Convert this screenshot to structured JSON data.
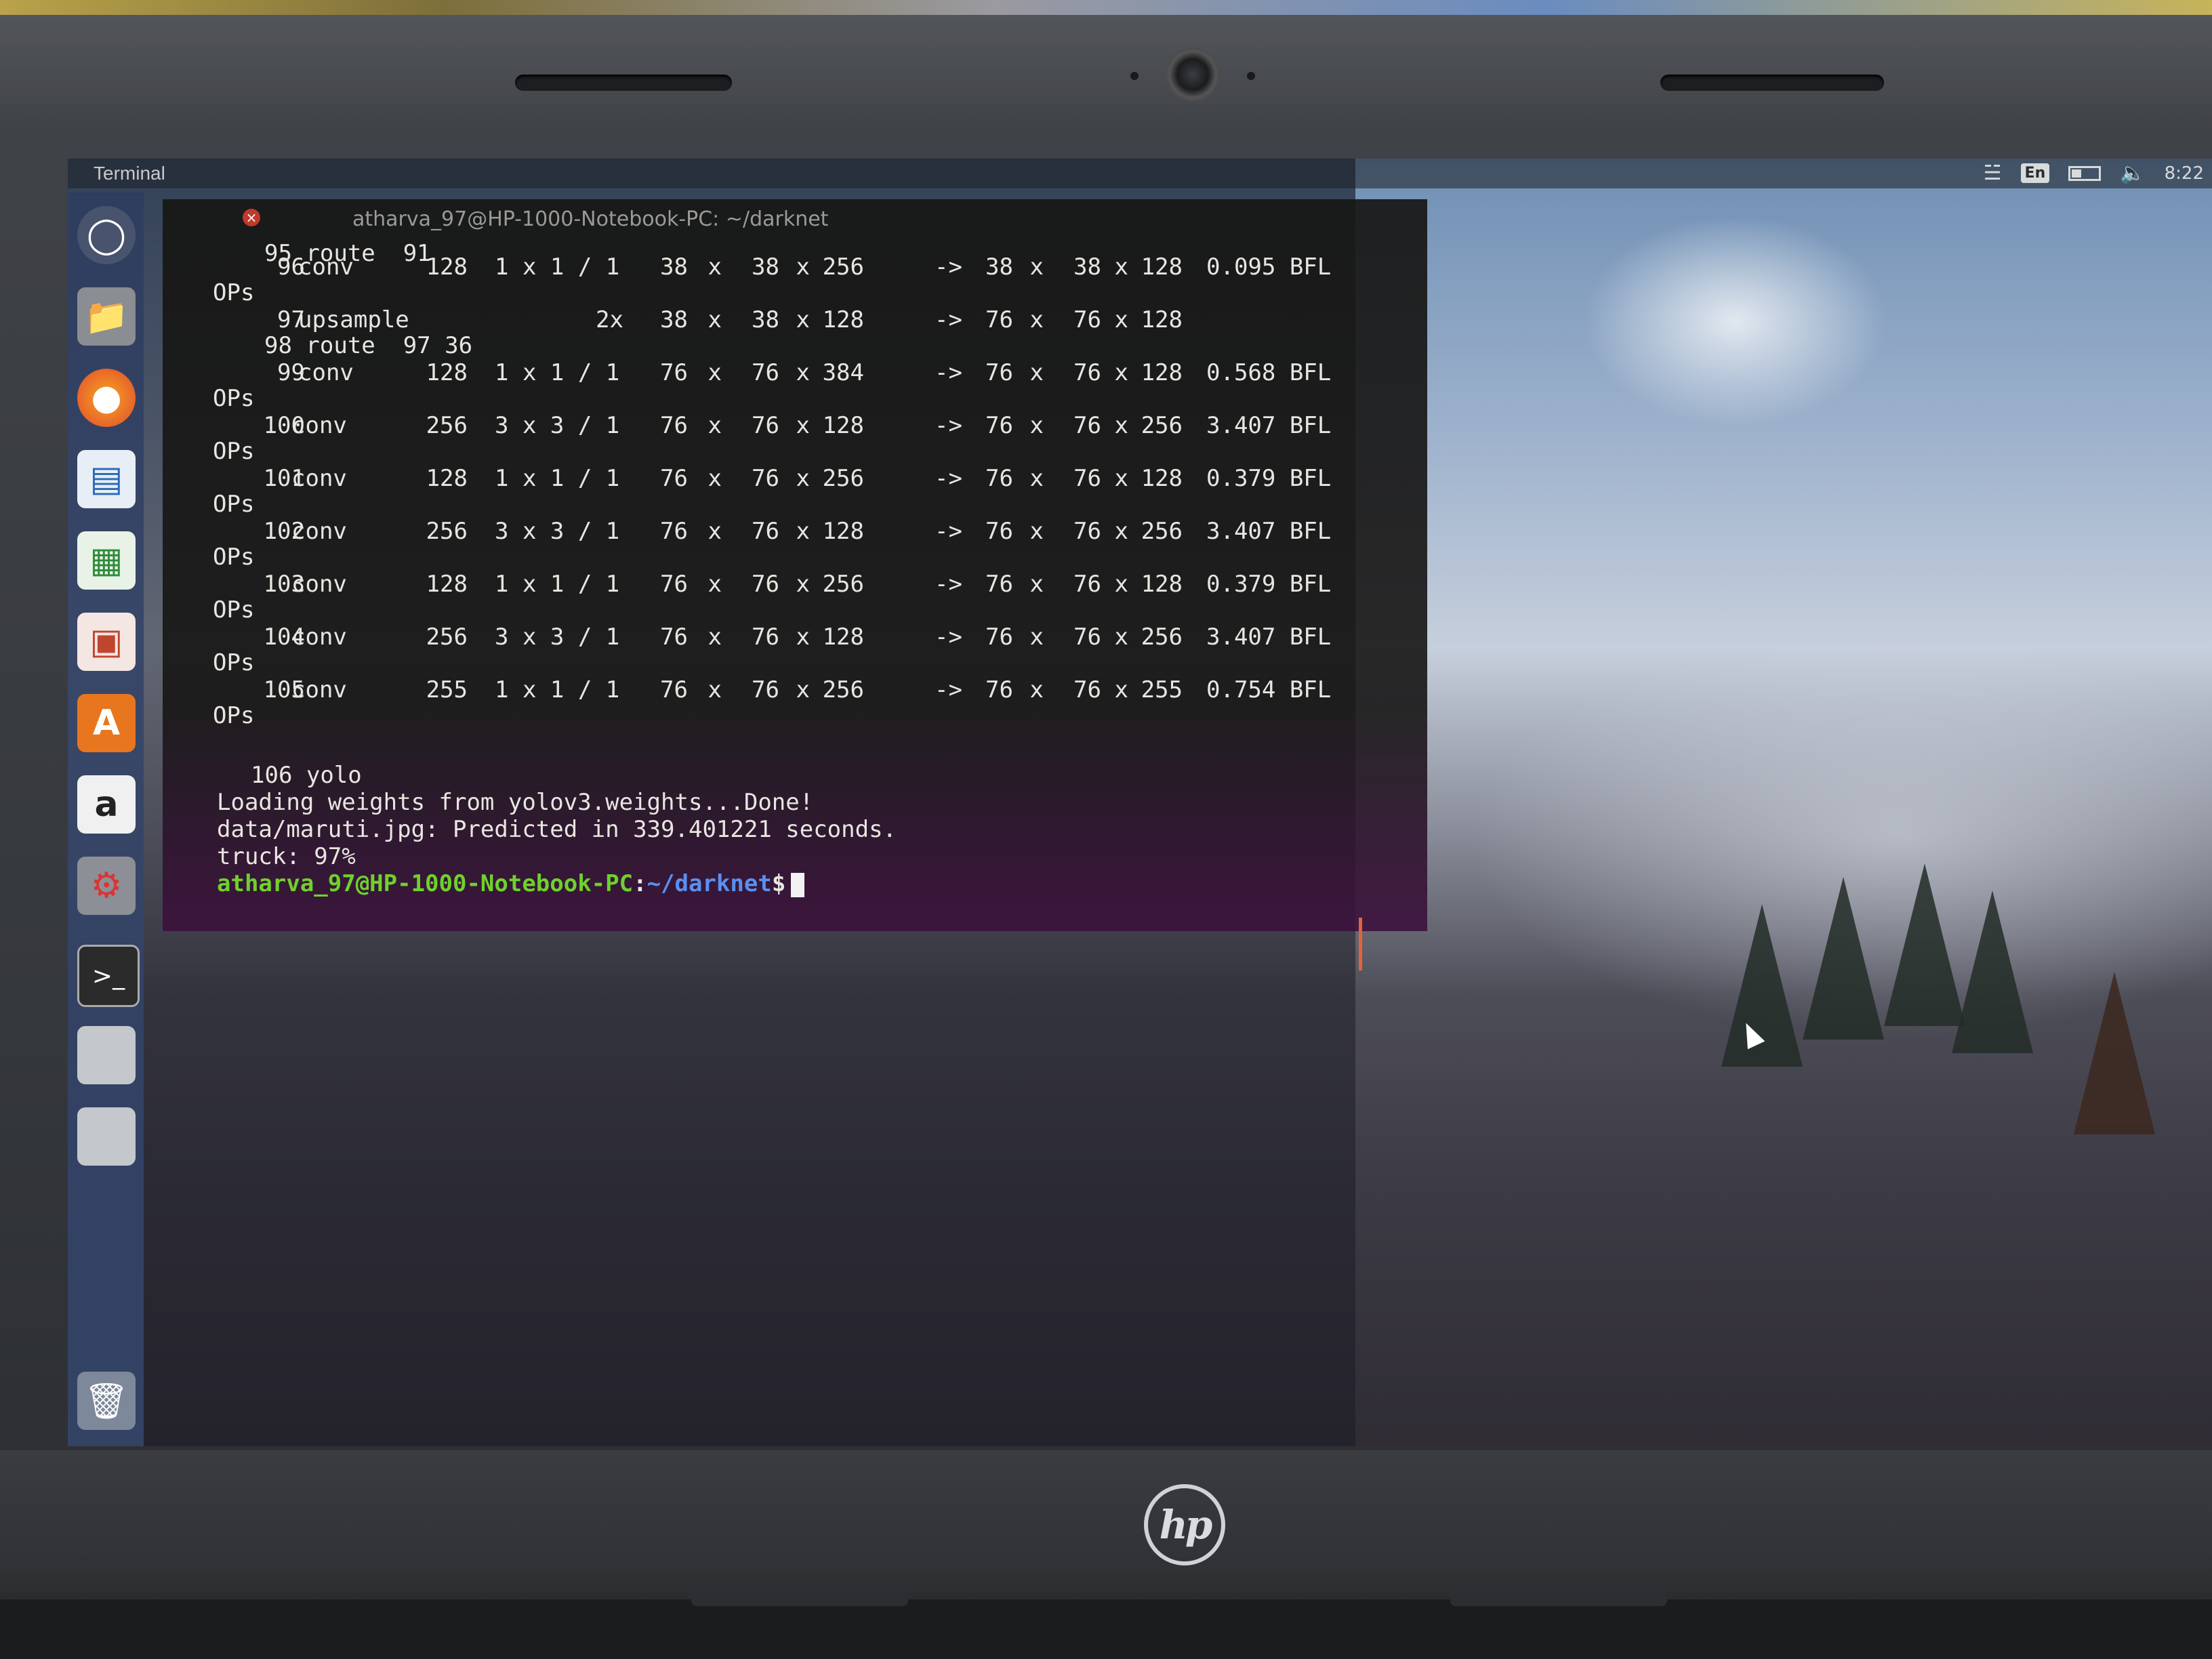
{
  "panel": {
    "app_name": "Terminal",
    "lang": "En",
    "clock": "8:22",
    "icons": {
      "wifi": "wifi-icon",
      "battery": "battery-icon",
      "volume": "volume-icon"
    }
  },
  "terminal": {
    "title": "atharva_97@HP-1000-Notebook-PC: ~/darknet",
    "top_lines": {
      "route95": "95 route  91"
    },
    "layers": [
      {
        "idx": "96",
        "type": "conv",
        "filters": "128",
        "size": "1 x 1 / 1",
        "in_w": "38",
        "in_h": "38",
        "in_c": "256",
        "out_w": "38",
        "out_h": "38",
        "out_c": "128",
        "bflops": "0.095 BFL",
        "ops": "OPs"
      },
      {
        "idx": "97",
        "type": "upsample",
        "filters": "",
        "size": "2x",
        "in_w": "38",
        "in_h": "38",
        "in_c": "128",
        "out_w": "76",
        "out_h": "76",
        "out_c": "128",
        "bflops": "",
        "ops": ""
      },
      {
        "idx": "99",
        "type": "conv",
        "filters": "128",
        "size": "1 x 1 / 1",
        "in_w": "76",
        "in_h": "76",
        "in_c": "384",
        "out_w": "76",
        "out_h": "76",
        "out_c": "128",
        "bflops": "0.568 BFL",
        "ops": "OPs"
      },
      {
        "idx": "100",
        "type": "conv",
        "filters": "256",
        "size": "3 x 3 / 1",
        "in_w": "76",
        "in_h": "76",
        "in_c": "128",
        "out_w": "76",
        "out_h": "76",
        "out_c": "256",
        "bflops": "3.407 BFL",
        "ops": "OPs"
      },
      {
        "idx": "101",
        "type": "conv",
        "filters": "128",
        "size": "1 x 1 / 1",
        "in_w": "76",
        "in_h": "76",
        "in_c": "256",
        "out_w": "76",
        "out_h": "76",
        "out_c": "128",
        "bflops": "0.379 BFL",
        "ops": "OPs"
      },
      {
        "idx": "102",
        "type": "conv",
        "filters": "256",
        "size": "3 x 3 / 1",
        "in_w": "76",
        "in_h": "76",
        "in_c": "128",
        "out_w": "76",
        "out_h": "76",
        "out_c": "256",
        "bflops": "3.407 BFL",
        "ops": "OPs"
      },
      {
        "idx": "103",
        "type": "conv",
        "filters": "128",
        "size": "1 x 1 / 1",
        "in_w": "76",
        "in_h": "76",
        "in_c": "256",
        "out_w": "76",
        "out_h": "76",
        "out_c": "128",
        "bflops": "0.379 BFL",
        "ops": "OPs"
      },
      {
        "idx": "104",
        "type": "conv",
        "filters": "256",
        "size": "3 x 3 / 1",
        "in_w": "76",
        "in_h": "76",
        "in_c": "128",
        "out_w": "76",
        "out_h": "76",
        "out_c": "256",
        "bflops": "3.407 BFL",
        "ops": "OPs"
      },
      {
        "idx": "105",
        "type": "conv",
        "filters": "255",
        "size": "1 x 1 / 1",
        "in_w": "76",
        "in_h": "76",
        "in_c": "256",
        "out_w": "76",
        "out_h": "76",
        "out_c": "255",
        "bflops": "0.754 BFL",
        "ops": "OPs"
      }
    ],
    "route98": "98 route  97 36",
    "yolo_line": "106 yolo",
    "loading_line": "Loading weights from yolov3.weights...Done!",
    "predicted_line": "data/maruti.jpg: Predicted in 339.401221 seconds.",
    "result_line": "truck: 97%",
    "prompt": {
      "user": "atharva_97@HP-1000-Notebook-PC",
      "sep": ":",
      "path": "~/darknet",
      "dollar": "$"
    },
    "arrow": "->",
    "times": "x"
  },
  "launcher": {
    "items": [
      "dash-icon",
      "files-icon",
      "firefox-icon",
      "writer-icon",
      "calc-icon",
      "impress-icon",
      "software-center-icon",
      "amazon-icon",
      "system-settings-icon",
      "terminal-icon",
      "drive-icon",
      "drive-icon",
      "trash-icon"
    ]
  },
  "hardware": {
    "logo": "hp"
  }
}
